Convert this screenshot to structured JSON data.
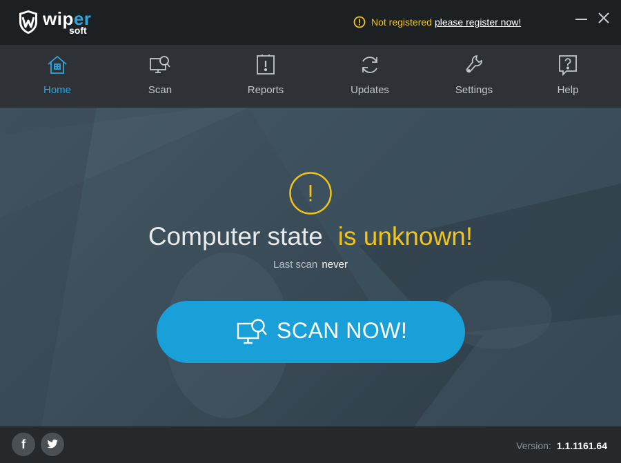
{
  "app": {
    "logo_text": "wiper",
    "logo_sub": "soft"
  },
  "titlebar": {
    "status_text": "Not registered",
    "register_link": "please register now!",
    "minimize_icon": "minimize-icon",
    "close_icon": "close-icon"
  },
  "nav": {
    "items": [
      {
        "label": "Home",
        "icon": "home-icon",
        "active": true
      },
      {
        "label": "Scan",
        "icon": "scan-icon",
        "active": false
      },
      {
        "label": "Reports",
        "icon": "reports-icon",
        "active": false
      },
      {
        "label": "Updates",
        "icon": "updates-icon",
        "active": false
      },
      {
        "label": "Settings",
        "icon": "settings-icon",
        "active": false
      },
      {
        "label": "Help",
        "icon": "help-icon",
        "active": false
      }
    ]
  },
  "main": {
    "state_prefix": "Computer state",
    "state_status": "is unknown!",
    "last_scan_label": "Last scan",
    "last_scan_value": "never",
    "scan_button": "SCAN NOW!"
  },
  "footer": {
    "facebook": "f",
    "version_label": "Version:",
    "version_value": "1.1.1161.64"
  },
  "colors": {
    "accent": "#2fa7dc",
    "warning": "#f0c419",
    "scan_button": "#1aa0d8"
  }
}
